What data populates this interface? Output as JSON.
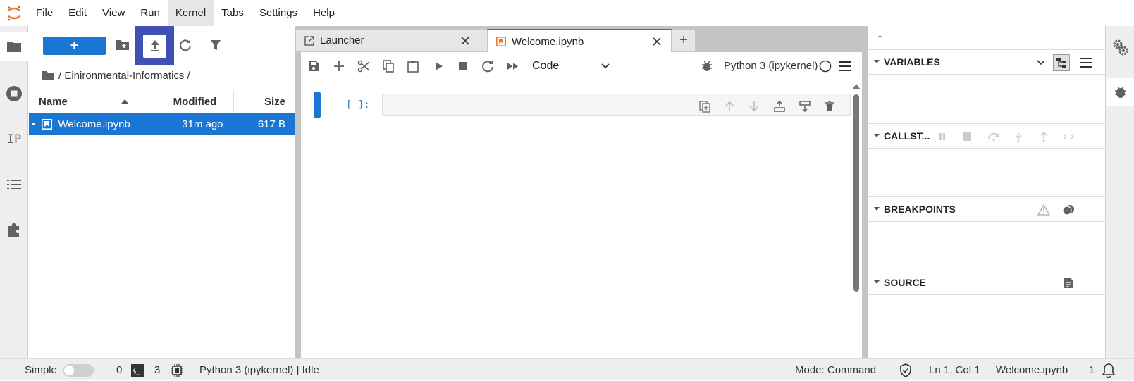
{
  "menu": [
    "File",
    "Edit",
    "View",
    "Run",
    "Kernel",
    "Tabs",
    "Settings",
    "Help"
  ],
  "active_menu": "Kernel",
  "left_sidebar": {
    "icons": [
      "folder-icon",
      "running-icon",
      "property-inspector-icon",
      "toc-icon",
      "extension-icon"
    ],
    "ip_label": "IP"
  },
  "file_browser": {
    "new_label": "+",
    "breadcrumb": "/ Einironmental-Informatics /",
    "columns": {
      "name": "Name",
      "modified": "Modified",
      "size": "Size"
    },
    "files": [
      {
        "name": "Welcome.ipynb",
        "modified": "31m ago",
        "size": "617 B",
        "running": "•"
      }
    ]
  },
  "tabs": [
    {
      "label": "Launcher"
    },
    {
      "label": "Welcome.ipynb"
    }
  ],
  "add_tab_label": "+",
  "notebook": {
    "cell_type": "Code",
    "kernel": "Python 3 (ipykernel)",
    "cells": [
      {
        "prompt": "[ ]:",
        "source": ""
      }
    ]
  },
  "debugger": {
    "top_label": "-",
    "sections": {
      "variables": "VARIABLES",
      "callstack": "CALLST...",
      "breakpoints": "BREAKPOINTS",
      "source": "SOURCE"
    }
  },
  "statusbar": {
    "simple_label": "Simple",
    "terminals_count": "0",
    "kernels_count": "3",
    "kernel_status": "Python 3 (ipykernel) | Idle",
    "mode": "Mode: Command",
    "position": "Ln 1, Col 1",
    "filename": "Welcome.ipynb",
    "notifications": "1"
  },
  "colors": {
    "accent": "#1976d2",
    "highlight": "#4051b5",
    "jupyter_orange": "#f37726"
  }
}
